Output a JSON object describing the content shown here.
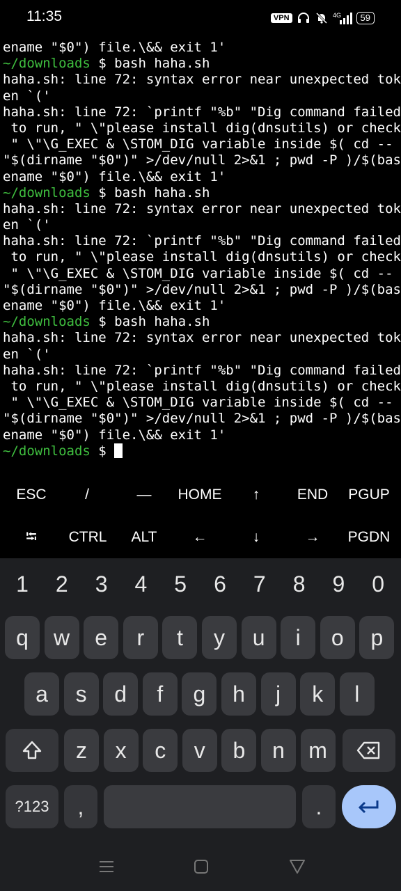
{
  "status": {
    "time": "11:35",
    "vpn": "VPN",
    "network": "4G",
    "battery": "59"
  },
  "terminal": {
    "lines": [
      {
        "prefix": "",
        "text": "ename \"$0\") file.\\&& exit 1'"
      },
      {
        "prefix": "~/downloads",
        "text": " $ bash haha.sh"
      },
      {
        "prefix": "",
        "text": "haha.sh: line 72: syntax error near unexpected tok"
      },
      {
        "prefix": "",
        "text": "en `('"
      },
      {
        "prefix": "",
        "text": "haha.sh: line 72: `printf \"%b\" \"Dig command failed"
      },
      {
        "prefix": "",
        "text": " to run, \" \\\"please install dig(dnsutils) or check"
      },
      {
        "prefix": "",
        "text": " \" \\\"\\G_EXEC & \\STOM_DIG variable inside $( cd --"
      },
      {
        "prefix": "",
        "text": "\"$(dirname \"$0\")\" >/dev/null 2>&1 ; pwd -P )/$(bas"
      },
      {
        "prefix": "",
        "text": "ename \"$0\") file.\\&& exit 1'"
      },
      {
        "prefix": "~/downloads",
        "text": " $ bash haha.sh"
      },
      {
        "prefix": "",
        "text": "haha.sh: line 72: syntax error near unexpected tok"
      },
      {
        "prefix": "",
        "text": "en `('"
      },
      {
        "prefix": "",
        "text": "haha.sh: line 72: `printf \"%b\" \"Dig command failed"
      },
      {
        "prefix": "",
        "text": " to run, \" \\\"please install dig(dnsutils) or check"
      },
      {
        "prefix": "",
        "text": " \" \\\"\\G_EXEC & \\STOM_DIG variable inside $( cd --"
      },
      {
        "prefix": "",
        "text": "\"$(dirname \"$0\")\" >/dev/null 2>&1 ; pwd -P )/$(bas"
      },
      {
        "prefix": "",
        "text": "ename \"$0\") file.\\&& exit 1'"
      },
      {
        "prefix": "~/downloads",
        "text": " $ bash haha.sh"
      },
      {
        "prefix": "",
        "text": "haha.sh: line 72: syntax error near unexpected tok"
      },
      {
        "prefix": "",
        "text": "en `('"
      },
      {
        "prefix": "",
        "text": "haha.sh: line 72: `printf \"%b\" \"Dig command failed"
      },
      {
        "prefix": "",
        "text": " to run, \" \\\"please install dig(dnsutils) or check"
      },
      {
        "prefix": "",
        "text": " \" \\\"\\G_EXEC & \\STOM_DIG variable inside $( cd --"
      },
      {
        "prefix": "",
        "text": "\"$(dirname \"$0\")\" >/dev/null 2>&1 ; pwd -P )/$(bas"
      },
      {
        "prefix": "",
        "text": "ename \"$0\") file.\\&& exit 1'"
      }
    ],
    "prompt": {
      "path": "~/downloads",
      "symbol": " $ "
    }
  },
  "extra_keys": {
    "row1": [
      {
        "label": "ESC",
        "name": "esc"
      },
      {
        "label": "/",
        "name": "slash"
      },
      {
        "label": "—",
        "name": "dash"
      },
      {
        "label": "HOME",
        "name": "home"
      },
      {
        "label": "↑",
        "name": "arrow-up"
      },
      {
        "label": "END",
        "name": "end"
      },
      {
        "label": "PGUP",
        "name": "pgup"
      }
    ],
    "row2": [
      {
        "label": "⭾",
        "name": "tab"
      },
      {
        "label": "CTRL",
        "name": "ctrl"
      },
      {
        "label": "ALT",
        "name": "alt"
      },
      {
        "label": "←",
        "name": "arrow-left"
      },
      {
        "label": "↓",
        "name": "arrow-down"
      },
      {
        "label": "→",
        "name": "arrow-right"
      },
      {
        "label": "PGDN",
        "name": "pgdn"
      }
    ]
  },
  "keyboard": {
    "numbers": [
      "1",
      "2",
      "3",
      "4",
      "5",
      "6",
      "7",
      "8",
      "9",
      "0"
    ],
    "row1": [
      "q",
      "w",
      "e",
      "r",
      "t",
      "y",
      "u",
      "i",
      "o",
      "p"
    ],
    "row2": [
      "a",
      "s",
      "d",
      "f",
      "g",
      "h",
      "j",
      "k",
      "l"
    ],
    "row3": [
      "z",
      "x",
      "c",
      "v",
      "b",
      "n",
      "m"
    ],
    "symbols_label": "?123",
    "comma": ",",
    "period": "."
  },
  "colors": {
    "prompt_path": "#3fbf3f",
    "keyboard_bg": "#1e1f22",
    "key_bg": "#3a3b3f",
    "enter_bg": "#a8c7fa"
  }
}
